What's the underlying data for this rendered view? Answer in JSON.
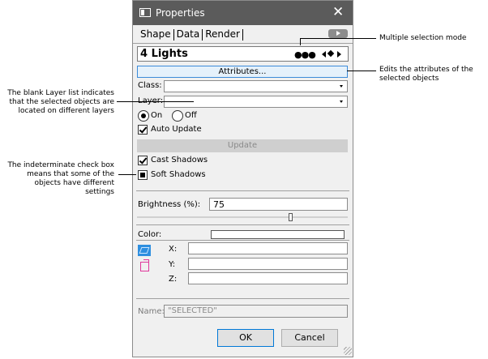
{
  "window": {
    "title": "Properties",
    "close_glyph": "✕"
  },
  "tabs": [
    {
      "label": "Shape"
    },
    {
      "label": "Data"
    },
    {
      "label": "Render"
    }
  ],
  "object_name": "4 Lights",
  "nav_dots": "●●●",
  "attributes_button": "Attributes...",
  "fields": {
    "class_label": "Class:",
    "layer_label": "Layer:"
  },
  "radios": [
    {
      "label": "On",
      "selected": true
    },
    {
      "label": "Off",
      "selected": false
    }
  ],
  "auto_update": {
    "label": "Auto Update",
    "checked": true
  },
  "update_button": "Update",
  "cast_shadows": {
    "label": "Cast Shadows",
    "checked": true
  },
  "soft_shadows": {
    "label": "Soft Shadows",
    "state": "indeterminate"
  },
  "brightness": {
    "label": "Brightness (%):",
    "value": "75"
  },
  "color": {
    "label": "Color:",
    "swatch": "#ffffff"
  },
  "xyz": {
    "x_label": "X:",
    "y_label": "Y:",
    "z_label": "Z:"
  },
  "name_field": {
    "label": "Name:",
    "value": "\"SELECTED\""
  },
  "buttons": {
    "ok": "OK",
    "cancel": "Cancel"
  },
  "icons": {
    "plane": "plane-icon",
    "cube": "cube-icon",
    "gear": "gear-icon"
  },
  "colors": {
    "titlebar": "#5b5b5b",
    "accent": "#0078d7",
    "panel": "#f0f0f0"
  },
  "callouts": {
    "multiple_selection": "Multiple selection mode",
    "attributes_line1": "Edits the attributes of the",
    "attributes_line2": "selected objects",
    "layer_line1": "The blank Layer list indicates",
    "layer_line2": "that the selected objects are",
    "layer_line3": "located on different layers",
    "check_line1": "The indeterminate check box",
    "check_line2": "means that some of the",
    "check_line3": "objects have different",
    "check_line4": "settings"
  }
}
